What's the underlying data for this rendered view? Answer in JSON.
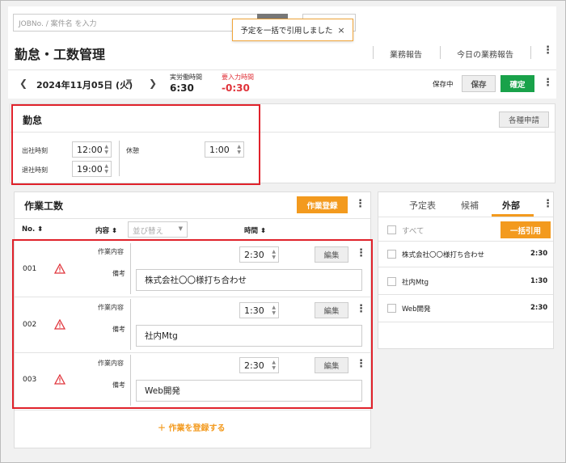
{
  "header": {
    "search_placeholder": "JOBNo. / 案件名 を入力",
    "toast_message": "予定を一括で引用しました",
    "toast_close": "×",
    "page_title": "勤怠・工数管理",
    "link_work_report": "業務報告",
    "link_today_report": "今日の業務報告"
  },
  "date_bar": {
    "date": "2024年11月05日 (火)",
    "actual_label": "実労働時間",
    "actual_value": "6:30",
    "required_label": "要入力時間",
    "required_value": "-0:30",
    "saving_status": "保存中",
    "save_label": "保存",
    "confirm_label": "確定"
  },
  "attendance": {
    "title": "勤怠",
    "request_label": "各種申請",
    "start_label": "出社時刻",
    "start_value": "12:00",
    "end_label": "退社時刻",
    "end_value": "19:00",
    "break_label": "休憩",
    "break_value": "1:00"
  },
  "work": {
    "title": "作業工数",
    "register_label": "作業登録",
    "col_no": "No.",
    "col_content": "内容",
    "sort_placeholder": "並び替え",
    "col_time": "時間",
    "content_label": "作業内容",
    "note_label": "備考",
    "edit_label": "編集",
    "add_label": "＋ 作業を登録する",
    "rows": [
      {
        "no": "001",
        "time": "2:30",
        "note": "株式会社〇〇様打ち合わせ"
      },
      {
        "no": "002",
        "time": "1:30",
        "note": "社内Mtg"
      },
      {
        "no": "003",
        "time": "2:30",
        "note": "Web開発"
      }
    ]
  },
  "side": {
    "tabs": [
      "予定表",
      "候補",
      "外部"
    ],
    "active_tab": 2,
    "select_all": "すべて",
    "bulk_cite": "一括引用",
    "items": [
      {
        "name": "株式会社〇〇様打ち合わせ",
        "time": "2:30"
      },
      {
        "name": "社内Mtg",
        "time": "1:30"
      },
      {
        "name": "Web開発",
        "time": "2:30"
      }
    ]
  },
  "colors": {
    "accent_orange": "#f39a1e",
    "confirm_green": "#19a24a",
    "alert_red": "#e0333a"
  }
}
